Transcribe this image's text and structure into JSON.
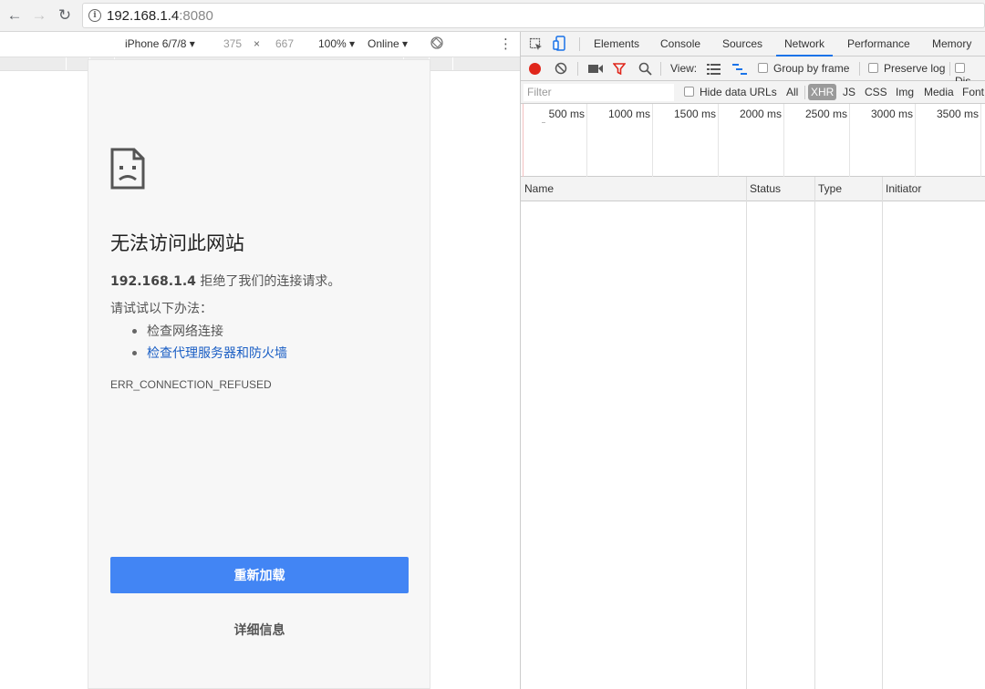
{
  "browser": {
    "url_host": "192.168.1.4",
    "url_port": ":8080"
  },
  "device_toolbar": {
    "device": "iPhone 6/7/8",
    "width": "375",
    "times": "×",
    "height": "667",
    "zoom": "100%",
    "network": "Online"
  },
  "error_page": {
    "title": "无法访问此网站",
    "host": "192.168.1.4",
    "description": " 拒绝了我们的连接请求。",
    "try_label": "请试试以下办法：",
    "suggestions": [
      "检查网络连接",
      "检查代理服务器和防火墙"
    ],
    "error_code": "ERR_CONNECTION_REFUSED",
    "reload_label": "重新加载",
    "details_label": "详细信息"
  },
  "devtools": {
    "tabs": [
      "Elements",
      "Console",
      "Sources",
      "Network",
      "Performance",
      "Memory"
    ],
    "active_tab": "Network",
    "toolbar": {
      "view_label": "View:",
      "group_by_frame": "Group by frame",
      "preserve_log": "Preserve log",
      "disable_cache": "Dis"
    },
    "filter": {
      "placeholder": "Filter",
      "hide_data_urls": "Hide data URLs",
      "types": [
        "All",
        "XHR",
        "JS",
        "CSS",
        "Img",
        "Media",
        "Font"
      ],
      "active_type": "XHR"
    },
    "timeline_ticks": [
      "500 ms",
      "1000 ms",
      "1500 ms",
      "2000 ms",
      "2500 ms",
      "3000 ms",
      "3500 ms"
    ],
    "columns": [
      "Name",
      "Status",
      "Type",
      "Initiator"
    ]
  },
  "colors": {
    "accent_blue": "#4285f4",
    "record_red": "#e0261b",
    "link_blue": "#1a5ec4"
  }
}
